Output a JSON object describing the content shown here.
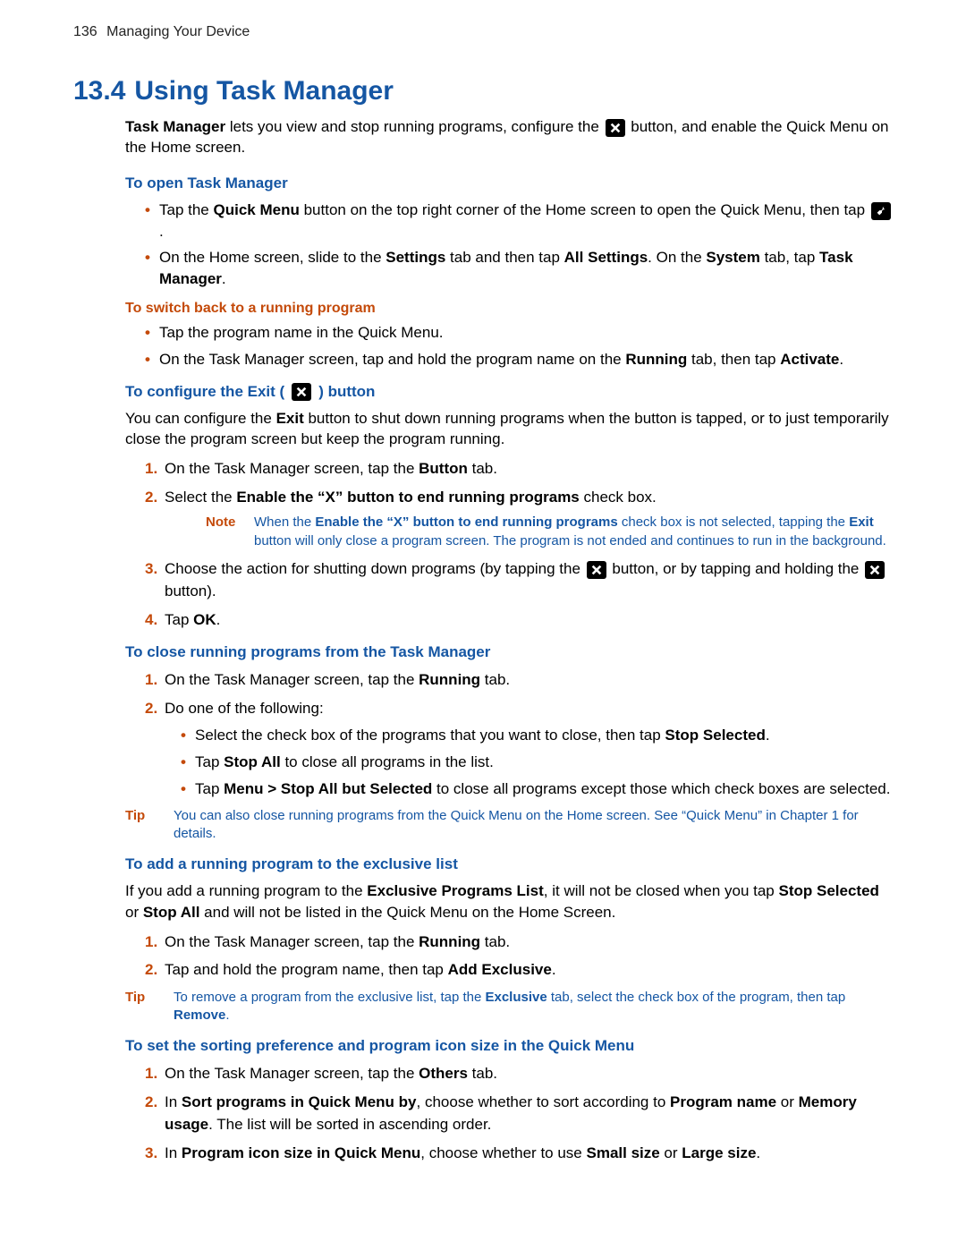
{
  "header": {
    "page_number": "136",
    "chapter": "Managing Your Device"
  },
  "section": {
    "number": "13.4",
    "title": "Using Task Manager"
  },
  "intro": {
    "p1a": "Task Manager",
    "p1b": " lets you view and stop running programs, configure the ",
    "p1c": " button, and enable the Quick Menu on the Home screen."
  },
  "open": {
    "heading": "To open Task Manager",
    "b1a": "Tap the ",
    "b1b": "Quick Menu",
    "b1c": " button on the top right corner of the Home screen to open the Quick Menu, then tap ",
    "b1d": ".",
    "b2a": "On the Home screen, slide to the ",
    "b2b": "Settings",
    "b2c": " tab and then tap ",
    "b2d": "All Settings",
    "b2e": ". On the ",
    "b2f": "System",
    "b2g": " tab, tap ",
    "b2h": "Task Manager",
    "b2i": "."
  },
  "switch": {
    "heading": "To switch back to a running program",
    "b1": "Tap the program name in the Quick Menu.",
    "b2a": "On the Task Manager screen, tap and hold the program name on the ",
    "b2b": "Running",
    "b2c": " tab, then tap ",
    "b2d": "Activate",
    "b2e": "."
  },
  "configure": {
    "heading_a": "To configure the Exit (",
    "heading_b": ") button",
    "p1a": "You can configure the ",
    "p1b": "Exit",
    "p1c": " button to shut down running programs when the button is tapped, or to just temporarily close the program screen but keep the program running.",
    "s1a": "On the Task Manager screen, tap the ",
    "s1b": "Button",
    "s1c": " tab.",
    "s2a": "Select the ",
    "s2b": "Enable the “X” button to end running programs",
    "s2c": " check box.",
    "note_label": "Note",
    "note_a": "When the ",
    "note_b": "Enable the “X” button to end running programs",
    "note_c": " check box is not selected, tapping the ",
    "note_d": "Exit",
    "note_e": " button will only close a program screen. The program is not ended and continues to run in the background.",
    "s3a": "Choose the action for shutting down programs (by tapping the ",
    "s3b": " button, or by tapping and holding the ",
    "s3c": " button).",
    "s4a": "Tap ",
    "s4b": "OK",
    "s4c": "."
  },
  "close": {
    "heading": "To close running programs from the Task Manager",
    "s1a": "On the Task Manager screen, tap the ",
    "s1b": "Running",
    "s1c": " tab.",
    "s2": "Do one of the following:",
    "sb1a": "Select the check box of the programs that you want to close, then tap ",
    "sb1b": "Stop Selected",
    "sb1c": ".",
    "sb2a": "Tap ",
    "sb2b": "Stop All",
    "sb2c": " to close all programs in the list.",
    "sb3a": "Tap ",
    "sb3b": "Menu > Stop All but Selected",
    "sb3c": " to close all programs except those which check boxes are selected.",
    "tip_label": "Tip",
    "tip_text": "You can also close running programs from the Quick Menu on the Home screen. See “Quick Menu” in Chapter 1 for details."
  },
  "exclusive": {
    "heading": "To add a running program to the exclusive list",
    "p1a": "If you add a running program to the ",
    "p1b": "Exclusive Programs List",
    "p1c": ", it will not be closed when you tap ",
    "p1d": "Stop Selected",
    "p1e": " or ",
    "p1f": "Stop All",
    "p1g": " and will not be listed in the Quick Menu on the Home Screen.",
    "s1a": "On the Task Manager screen, tap the ",
    "s1b": "Running",
    "s1c": " tab.",
    "s2a": "Tap and hold the program name, then tap ",
    "s2b": "Add Exclusive",
    "s2c": ".",
    "tip_label": "Tip",
    "tip_a": "To remove a program from the exclusive list, tap the ",
    "tip_b": "Exclusive",
    "tip_c": " tab, select the check box of the program, then tap ",
    "tip_d": "Remove",
    "tip_e": "."
  },
  "sorting": {
    "heading": "To set the sorting preference and program icon size in the Quick Menu",
    "s1a": "On the Task Manager screen, tap the ",
    "s1b": "Others",
    "s1c": " tab.",
    "s2a": "In ",
    "s2b": "Sort programs in Quick Menu by",
    "s2c": ", choose whether to sort according to ",
    "s2d": "Program name",
    "s2e": " or ",
    "s2f": "Memory usage",
    "s2g": ". The list will be sorted in ascending order.",
    "s3a": "In ",
    "s3b": "Program icon size in Quick Menu",
    "s3c": ", choose whether to use ",
    "s3d": "Small size",
    "s3e": " or ",
    "s3f": "Large size",
    "s3g": "."
  }
}
